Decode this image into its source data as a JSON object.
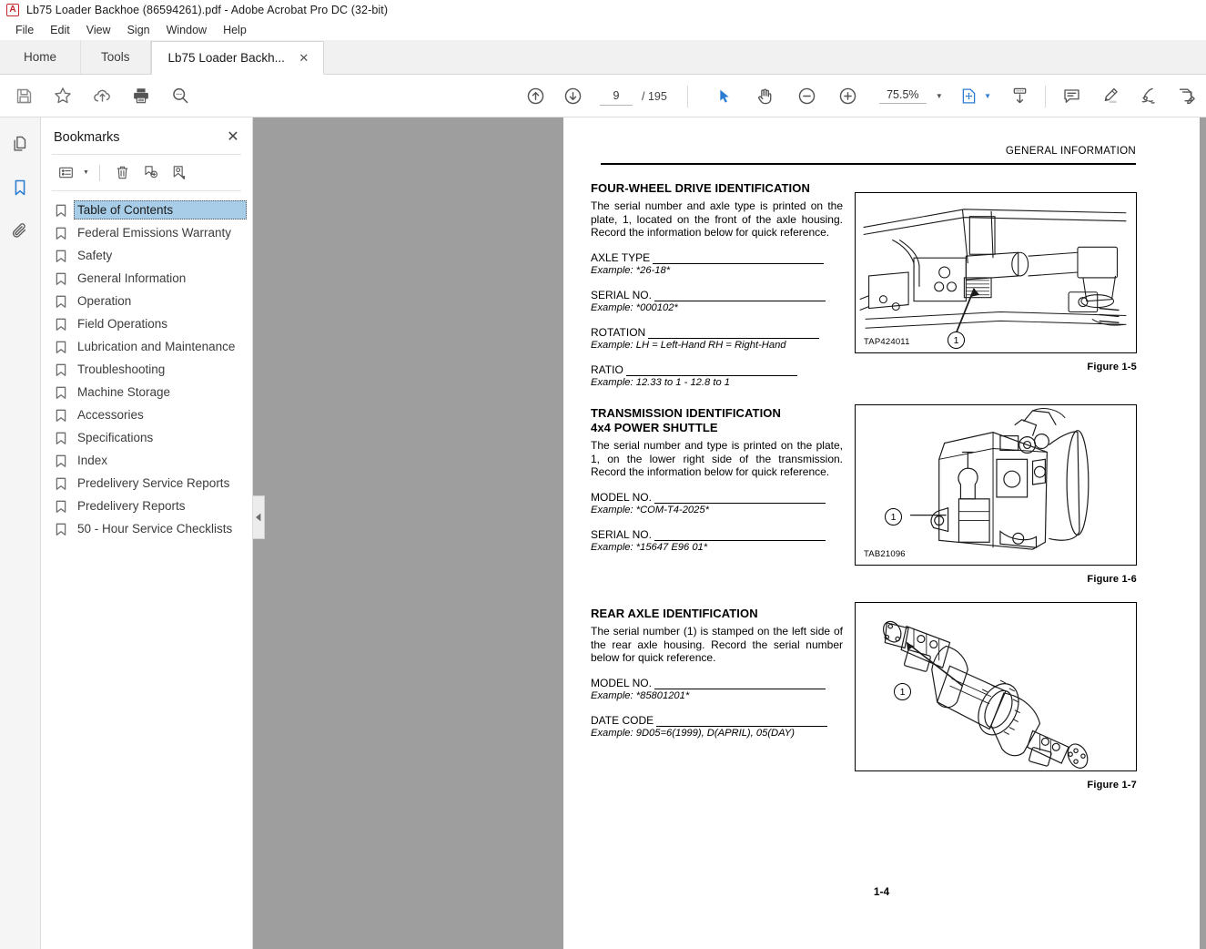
{
  "window": {
    "title": "Lb75 Loader Backhoe (86594261).pdf - Adobe Acrobat Pro DC (32-bit)",
    "app_icon": "adobe-acrobat-icon"
  },
  "menubar": {
    "items": [
      "File",
      "Edit",
      "View",
      "Sign",
      "Window",
      "Help"
    ]
  },
  "tabs": {
    "home_label": "Home",
    "tools_label": "Tools",
    "document_label": "Lb75 Loader Backh...",
    "close_label": "✕"
  },
  "toolbar": {
    "left_icons": [
      {
        "name": "save-icon",
        "title": "Save"
      },
      {
        "name": "star-icon",
        "title": "Add to favorites"
      },
      {
        "name": "cloud-upload-icon",
        "title": "Upload"
      },
      {
        "name": "print-icon",
        "title": "Print"
      },
      {
        "name": "search-icon",
        "title": "Find"
      }
    ],
    "prev_page_title": "Previous page",
    "next_page_title": "Next page",
    "page_current": "9",
    "page_total": "/ 195",
    "select_tool_title": "Select tool",
    "hand_tool_title": "Hand tool",
    "zoom_out_title": "Zoom out",
    "zoom_in_title": "Zoom in",
    "zoom_level": "75.5%",
    "fit_page_title": "Fit page",
    "scroll_mode_title": "Page display",
    "right_icons": [
      {
        "name": "comment-icon",
        "title": "Comment"
      },
      {
        "name": "highlight-icon",
        "title": "Highlight text"
      },
      {
        "name": "sign-icon",
        "title": "Sign"
      },
      {
        "name": "fill-sign-icon",
        "title": "Fill & Sign"
      }
    ]
  },
  "navrail": {
    "items": [
      {
        "name": "page-thumbnails-icon",
        "active": false
      },
      {
        "name": "bookmarks-icon",
        "active": true
      },
      {
        "name": "attachments-icon",
        "active": false
      }
    ]
  },
  "bookmarks_panel": {
    "title": "Bookmarks",
    "close_label": "✕",
    "tools": [
      {
        "name": "bookmark-options-icon"
      },
      {
        "name": "delete-bookmark-icon"
      },
      {
        "name": "new-bookmark-icon"
      },
      {
        "name": "find-bookmark-icon"
      }
    ],
    "items": [
      {
        "label": "Table of Contents",
        "selected": true
      },
      {
        "label": "Federal Emissions Warranty",
        "selected": false
      },
      {
        "label": "Safety",
        "selected": false
      },
      {
        "label": "General Information",
        "selected": false
      },
      {
        "label": "Operation",
        "selected": false
      },
      {
        "label": "Field Operations",
        "selected": false
      },
      {
        "label": "Lubrication and Maintenance",
        "selected": false
      },
      {
        "label": "Troubleshooting",
        "selected": false
      },
      {
        "label": "Machine Storage",
        "selected": false
      },
      {
        "label": "Accessories",
        "selected": false
      },
      {
        "label": "Specifications",
        "selected": false
      },
      {
        "label": "Index",
        "selected": false
      },
      {
        "label": "Predelivery Service Reports",
        "selected": false
      },
      {
        "label": "Predelivery Reports",
        "selected": false
      },
      {
        "label": "50 - Hour Service Checklists",
        "selected": false
      }
    ]
  },
  "document": {
    "running_header": "GENERAL INFORMATION",
    "page_footer": "1-4",
    "sections": [
      {
        "title": "FOUR-WHEEL DRIVE IDENTIFICATION",
        "body": "The serial number and axle type is printed on the plate, 1, located on the front of the axle housing. Record the information below for quick reference.",
        "fields": [
          {
            "label": "AXLE TYPE",
            "example": "Example: *26-18*"
          },
          {
            "label": "SERIAL NO.",
            "example": "Example: *000102*"
          },
          {
            "label": "ROTATION",
            "example": "Example: LH = Left-Hand RH = Right-Hand"
          },
          {
            "label": "RATIO",
            "example": "Example: 12.33 to 1 - 12.8 to 1"
          }
        ]
      },
      {
        "title": "TRANSMISSION IDENTIFICATION",
        "subtitle": "4x4 POWER SHUTTLE",
        "body": "The serial number and type is printed on the plate, 1, on the lower right side of the transmission. Record the information below for quick reference.",
        "fields": [
          {
            "label": "MODEL NO.",
            "example": "Example: *COM-T4-2025*"
          },
          {
            "label": "SERIAL NO.",
            "example": "Example: *15647 E96 01*"
          }
        ]
      },
      {
        "title": "REAR AXLE IDENTIFICATION",
        "body": "The serial number (1) is stamped on the left side of the rear axle housing. Record the serial number below for quick reference.",
        "fields": [
          {
            "label": "MODEL NO.",
            "example": "Example: *85801201*"
          },
          {
            "label": "DATE CODE",
            "example": "Example: 9D05=6(1999), D(APRIL), 05(DAY)"
          }
        ]
      }
    ],
    "figures": [
      {
        "code": "TAP424011",
        "caption": "Figure 1-5",
        "callout": "1",
        "alt": "front-axle-diagram"
      },
      {
        "code": "TAB21096",
        "caption": "Figure 1-6",
        "callout": "1",
        "alt": "transmission-diagram"
      },
      {
        "code": "",
        "caption": "Figure 1-7",
        "callout": "1",
        "alt": "rear-axle-diagram"
      }
    ]
  },
  "colors": {
    "accent": "#2b7cd3",
    "selection": "#a8cde8",
    "viewport": "#9e9e9e",
    "chrome": "#f1f1f1"
  }
}
